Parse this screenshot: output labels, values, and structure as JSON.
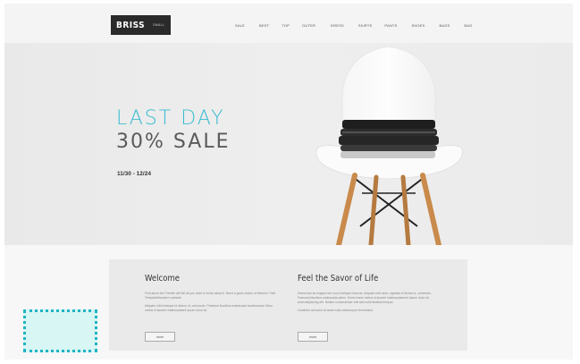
{
  "header": {
    "logo_main": "BRISS",
    "logo_sub": "SMALL",
    "nav": [
      "SALE",
      "BEST",
      "TOP",
      "OUTER",
      "DRESS",
      "SKIRTS",
      "PANTS",
      "SHOES",
      "BAGS",
      "BAG"
    ]
  },
  "hero": {
    "line1": "LAST DAY",
    "line2": "30% SALE",
    "dates": "11/30 - 12/24"
  },
  "content": {
    "left": {
      "title": "Welcome",
      "text1": "Find about the Freebie will tell all you need to know about it. Need a good choice of themes? Visit TemplateMonster's website.",
      "text2": "Aliquam nibh tristique id dictum ut, commodo. Praesent faucibus malesuada faucibusmoe Seeo metus id laoreet malesuadaent ipsum dolor sit.",
      "button": "more"
    },
    "right": {
      "title": "Feel the Savor of Life",
      "text1": "Demeorse an magna non nunc tristique rhoncus. Aliquam nibh ante, egestas id dictum a, commodo. Praesent faucibus malesuada aritus. Donec base metus id laoreet malesuadament ipsum dolor sit amet adipiscing elit. Nullam consectetuer edit sed nulla facilisis tempus.",
      "text2": "Curabitur ad lorem at amet nulla ullamcorper fermentum.",
      "button": "more"
    }
  },
  "colors": {
    "accent": "#3bbcd0",
    "selection_border": "#1fb3c3",
    "selection_fill": "#d8f6f4"
  }
}
